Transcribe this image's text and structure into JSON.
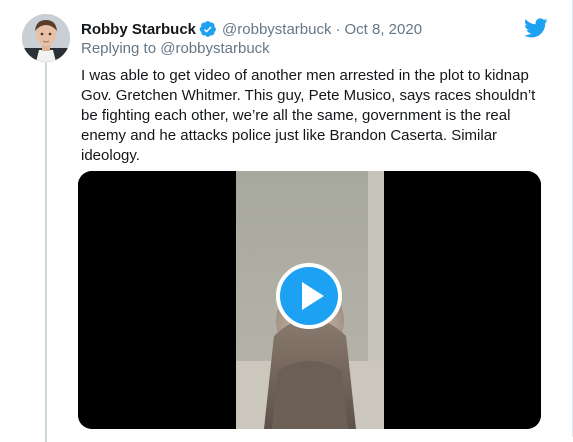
{
  "tweet": {
    "author_name": "Robby Starbuck",
    "author_handle": "@robbystarbuck",
    "separator": "·",
    "date": "Oct 8, 2020",
    "reply_prefix": "Replying to ",
    "reply_mention": "@robbystarbuck",
    "text": "I was able to get video of another men arrested in the plot to kidnap\nGov. Gretchen Whitmer. This guy, Pete Musico, says races shouldn’t\nbe fighting each other, we’re all the same, government is the real\nenemy and he attacks police just like Brandon Caserta. Similar\nideology."
  },
  "icons": {
    "verified": "verified-badge-icon",
    "logo": "twitter-bird-icon",
    "play": "play-icon"
  },
  "colors": {
    "brand_blue": "#1da1f2",
    "text": "#14171a",
    "muted": "#657786",
    "video_bg": "#000000"
  }
}
